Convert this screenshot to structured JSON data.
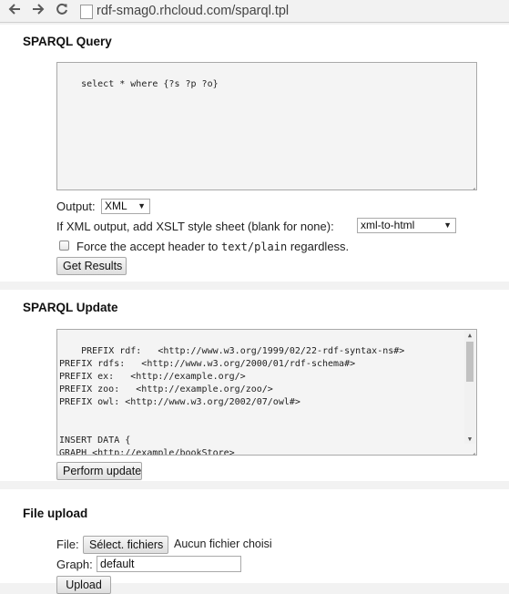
{
  "browser": {
    "url": "rdf-smag0.rhcloud.com/sparql.tpl",
    "back_icon": "back-arrow-icon",
    "forward_icon": "forward-arrow-icon",
    "reload_icon": "reload-icon"
  },
  "query": {
    "title": "SPARQL Query",
    "text": "select * where {?s ?p ?o}",
    "output_label": "Output:",
    "output_value": "XML",
    "xslt_label": "If XML output, add XSLT style sheet (blank for none):",
    "xslt_value": "xml-to-html",
    "force_pre": "Force the accept header to ",
    "force_code": "text/plain",
    "force_post": " regardless.",
    "button": "Get Results"
  },
  "update": {
    "title": "SPARQL Update",
    "text": "PREFIX rdf:   <http://www.w3.org/1999/02/22-rdf-syntax-ns#>\nPREFIX rdfs:   <http://www.w3.org/2000/01/rdf-schema#>\nPREFIX ex:   <http://example.org/>\nPREFIX zoo:   <http://example.org/zoo/>\nPREFIX owl: <http://www.w3.org/2002/07/owl#>\n\n\nINSERT DATA {\nGRAPH <http://example/bookStore>\n{",
    "button": "Perform update"
  },
  "upload": {
    "title": "File upload",
    "file_label": "File:",
    "file_button": "Sélect. fichiers",
    "file_status": "Aucun fichier choisi",
    "graph_label": "Graph:",
    "graph_value": "default",
    "button": "Upload"
  }
}
